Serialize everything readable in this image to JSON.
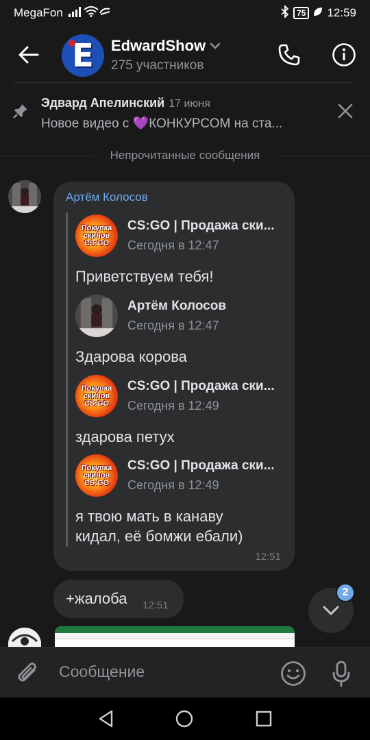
{
  "status_bar": {
    "carrier": "MegaFon",
    "battery": "75",
    "time": "12:59"
  },
  "header": {
    "title": "EdwardShow",
    "subtitle": "275 участников",
    "avatar_letter": "E"
  },
  "pinned": {
    "author": "Эдвард Апелинский",
    "date": "17 июня",
    "text": "Новое видео с 💜КОНКУРСОМ на ста..."
  },
  "unread_divider": "Непрочитанные сообщения",
  "message": {
    "author": "Артём Колосов",
    "time": "12:51",
    "forwarded": [
      {
        "name": "CS:GO | Продажа ски...",
        "time": "Сегодня в 12:47",
        "text": "Приветствуем тебя!",
        "avatar": "logo"
      },
      {
        "name": "Артём Колосов",
        "time": "Сегодня в 12:47",
        "text": "Здарова корова",
        "avatar": "user"
      },
      {
        "name": "CS:GO | Продажа ски...",
        "time": "Сегодня в 12:49",
        "text": "здарова петух",
        "avatar": "logo"
      },
      {
        "name": "CS:GO | Продажа ски...",
        "time": "Сегодня в 12:49",
        "text": "я твою мать в канаву кидал, её бомжи ебали)",
        "avatar": "logo"
      }
    ],
    "logo_text": "Покупка скинов CS:GO"
  },
  "message2": {
    "text": "+жалоба",
    "time": "12:51"
  },
  "fab": {
    "badge": "2"
  },
  "composer": {
    "placeholder": "Сообщение"
  }
}
